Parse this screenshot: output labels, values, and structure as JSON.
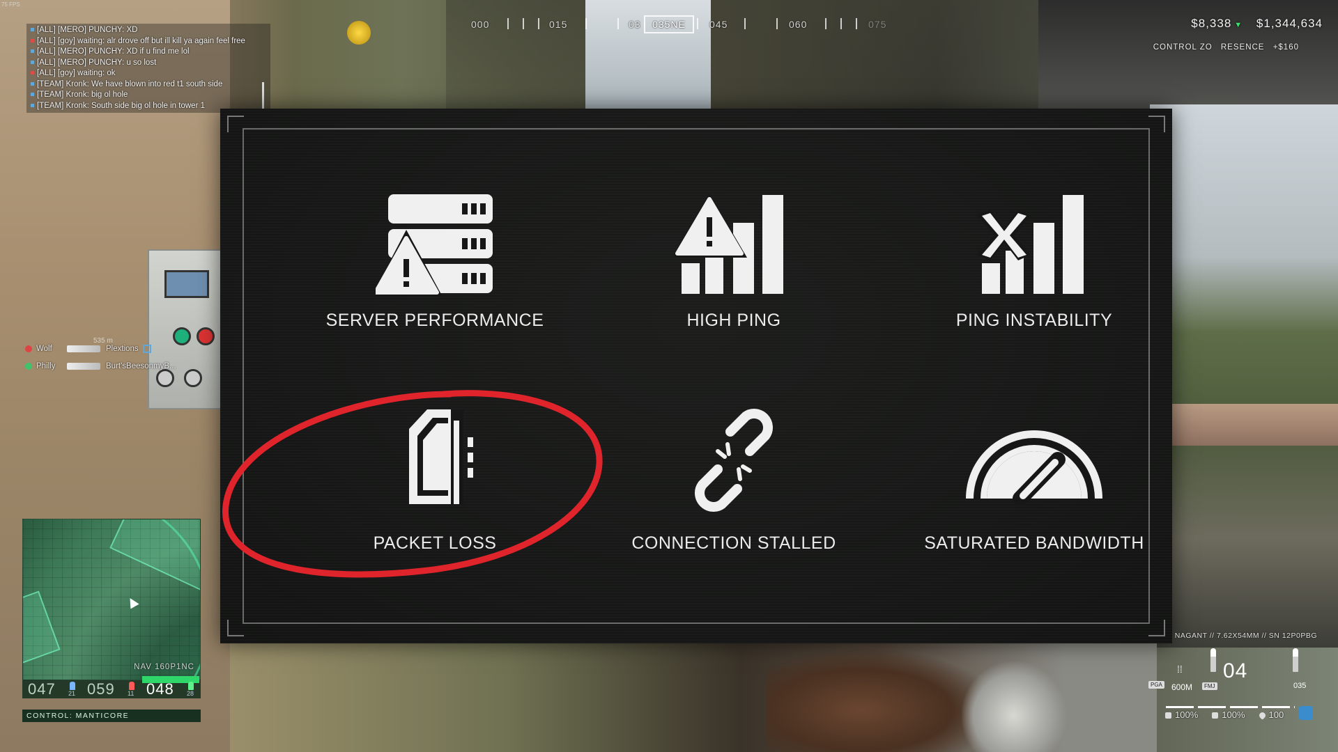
{
  "fps": "75 FPS",
  "chat": [
    {
      "channel_color": "#5fa8d9",
      "text": "[ALL] [MERO] PUNCHY: XD"
    },
    {
      "channel_color": "#e24a4a",
      "text": "[ALL] [goy] waiting: alr drove off but ill kill ya again feel free"
    },
    {
      "channel_color": "#5fa8d9",
      "text": "[ALL] [MERO] PUNCHY: XD if u find me lol"
    },
    {
      "channel_color": "#5fa8d9",
      "text": "[ALL] [MERO] PUNCHY: u so lost"
    },
    {
      "channel_color": "#e24a4a",
      "text": "[ALL] [goy] waiting: ok"
    },
    {
      "channel_color": "#5fa8d9",
      "text": "[TEAM] Kronk: We have blown into red t1 south side"
    },
    {
      "channel_color": "#5fa8d9",
      "text": "[TEAM] Kronk: big ol hole"
    },
    {
      "channel_color": "#5fa8d9",
      "text": "[TEAM] Kronk: South side big ol hole in tower 1"
    }
  ],
  "compass": {
    "ticks": [
      "000",
      "015",
      "03",
      "045",
      "060",
      "075"
    ],
    "current": "035NE"
  },
  "money": {
    "cash": "$8,338",
    "bank": "$1,344,634"
  },
  "zone_presence": {
    "label_left": "CONTROL ZO",
    "label_right": "RESENCE",
    "bonus": "+$160"
  },
  "squad": {
    "distance": "535 m",
    "members": [
      {
        "name": "Wolf",
        "killed": "Plextions",
        "status_color": "#d44"
      },
      {
        "name": "Philly",
        "killed": "Burt'sBeesonmyB...",
        "status_color": "#3ec46a"
      }
    ]
  },
  "minimap": {
    "nav_label": "NAV 160P1NC",
    "tickets": {
      "team_a": "047",
      "team_a_count": "21",
      "team_b": "059",
      "team_b_count": "11",
      "team_c": "048",
      "team_c_count": "28"
    },
    "progress": 0.85,
    "zone_label": "CONTROL: MANTICORE"
  },
  "network_warnings": [
    {
      "id": "server-performance",
      "label": "SERVER PERFORMANCE",
      "icon": "server-warning-icon"
    },
    {
      "id": "high-ping",
      "label": "HIGH PING",
      "icon": "high-ping-icon"
    },
    {
      "id": "ping-instability",
      "label": "PING INSTABILITY",
      "icon": "ping-instability-icon"
    },
    {
      "id": "packet-loss",
      "label": "PACKET LOSS",
      "icon": "packet-loss-icon",
      "highlighted": true
    },
    {
      "id": "connection-stalled",
      "label": "CONNECTION STALLED",
      "icon": "broken-chain-icon"
    },
    {
      "id": "saturated-bandwidth",
      "label": "SATURATED BANDWIDTH",
      "icon": "speedometer-icon"
    }
  ],
  "highlight_color": "#e0242b",
  "weapon": {
    "info": "NAGANT // 7.62X54MM // SN 12P0PBG",
    "mag": "04",
    "reserve": "035",
    "range": "600M",
    "sight": "PGA",
    "ammo_type": "FMJ"
  },
  "vitals": {
    "stamina": "100%",
    "armor": "100%",
    "health": "100"
  }
}
